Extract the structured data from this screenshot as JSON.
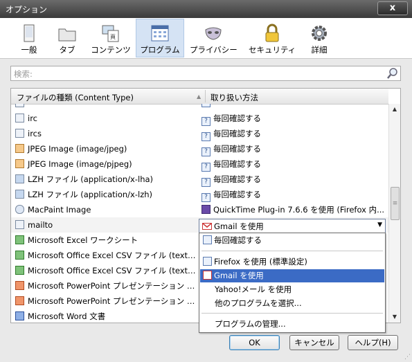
{
  "window": {
    "title": "オプション",
    "close_label": "x"
  },
  "toolbar": {
    "items": [
      {
        "label": "一般",
        "icon": "general-icon"
      },
      {
        "label": "タブ",
        "icon": "tabs-icon"
      },
      {
        "label": "コンテンツ",
        "icon": "content-icon"
      },
      {
        "label": "プログラム",
        "icon": "applications-icon",
        "selected": true
      },
      {
        "label": "プライバシー",
        "icon": "privacy-mask-icon"
      },
      {
        "label": "セキュリティ",
        "icon": "security-lock-icon"
      },
      {
        "label": "詳細",
        "icon": "advanced-gear-icon"
      }
    ]
  },
  "search": {
    "placeholder": "検索:"
  },
  "table": {
    "col_type": "ファイルの種類 (Content Type)",
    "col_action": "取り扱い方法",
    "rows": [
      {
        "type": "irc",
        "action": "毎回確認する"
      },
      {
        "type": "ircs",
        "action": "毎回確認する"
      },
      {
        "type": "JPEG Image (image/jpeg)",
        "action": "毎回確認する"
      },
      {
        "type": "JPEG Image (image/pjpeg)",
        "action": "毎回確認する"
      },
      {
        "type": "LZH ファイル (application/x-lha)",
        "action": "毎回確認する"
      },
      {
        "type": "LZH ファイル (application/x-lzh)",
        "action": "毎回確認する"
      },
      {
        "type": "MacPaint Image",
        "action": "QuickTime Plug-in 7.6.6 を使用 (Firefox 内..."
      },
      {
        "type": "mailto",
        "action": ""
      },
      {
        "type": "Microsoft Excel ワークシート",
        "action": ""
      },
      {
        "type": "Microsoft Office Excel CSV ファイル (text/...",
        "action": ""
      },
      {
        "type": "Microsoft Office Excel CSV ファイル (text/...",
        "action": ""
      },
      {
        "type": "Microsoft PowerPoint プレゼンテーション (...",
        "action": ""
      },
      {
        "type": "Microsoft PowerPoint プレゼンテーション (...",
        "action": ""
      },
      {
        "type": "Microsoft Word 文書",
        "action": ""
      }
    ]
  },
  "combo": {
    "value": "Gmail を使用"
  },
  "menu": {
    "ask": "毎回確認する",
    "firefox": "Firefox を使用 (標準設定)",
    "gmail": "Gmail を使用",
    "yahoo": "Yahoo!メール を使用",
    "other": "他のプログラムを選択...",
    "manage": "プログラムの管理..."
  },
  "buttons": {
    "ok": "OK",
    "cancel": "キャンセル",
    "help": "ヘルプ(H)"
  },
  "colors": {
    "highlight": "#3b6bc5",
    "toolbar_selected": "#d5e3f4"
  }
}
